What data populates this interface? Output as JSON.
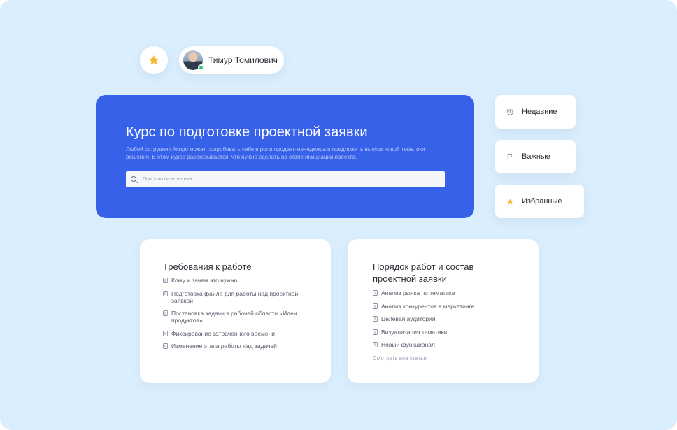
{
  "user": {
    "name": "Тимур Томилович"
  },
  "hero": {
    "title": "Курс по подготовке проектной заявки",
    "description": "Любой сотрудник Аспро может попробовать себя в роли продакт-менеджера и предложить выпуск новой тематики решения. В этом курсе рассказывается, что нужно сделать на этапе инициации проекта.",
    "search_placeholder": "Поиск по базе знаний"
  },
  "side_menu": {
    "recent": "Недавние",
    "important": "Важные",
    "favorites": "Избранные"
  },
  "cards": [
    {
      "title": "Требования к работе",
      "items": [
        "Кому и зачем это нужно",
        "Подготовка файла для работы над проектной заявкой",
        "Постановка задачи в рабочей области «Идеи продуктов»",
        "Фиксирование затраченного времени",
        "Изменение этапа работы над задачей"
      ]
    },
    {
      "title": "Порядок работ и состав проектной заявки",
      "items": [
        "Анализ рынка по тематике",
        "Анализ конкурентов в маркетинге",
        "Целевая аудитория",
        "Визуализация тематики",
        "Новый функционал"
      ],
      "see_all": "Смотреть все статьи"
    }
  ],
  "colors": {
    "background": "#dbeefd",
    "hero": "#3661e8",
    "star": "#f8b636",
    "online": "#2ec66b"
  },
  "icons": {
    "favorite": "star-icon",
    "recent": "history-icon",
    "important": "flag-icon",
    "search": "search-icon",
    "article": "document-icon"
  }
}
